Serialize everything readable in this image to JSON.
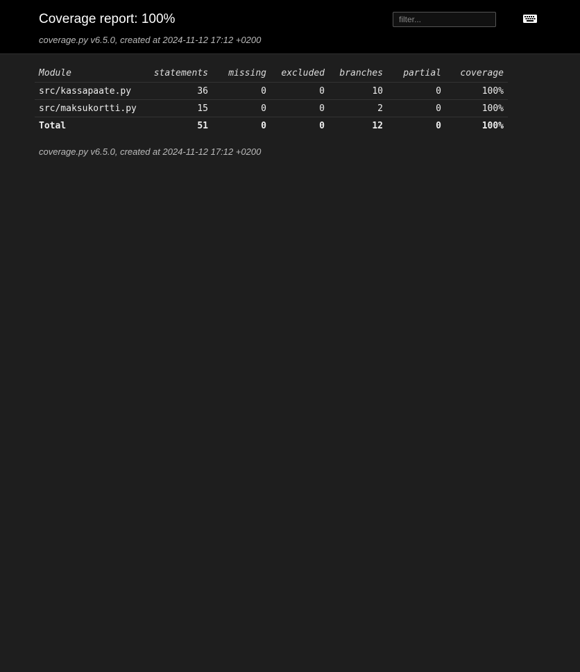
{
  "header": {
    "title": "Coverage report: 100%",
    "created": "coverage.py v6.5.0, created at 2024-11-12 17:12 +0200",
    "filter_placeholder": "filter...",
    "keyboard_icon": "keyboard-icon"
  },
  "table": {
    "columns": [
      "Module",
      "statements",
      "missing",
      "excluded",
      "branches",
      "partial",
      "coverage"
    ],
    "rows": [
      {
        "module": "src/kassapaate.py",
        "statements": "36",
        "missing": "0",
        "excluded": "0",
        "branches": "10",
        "partial": "0",
        "coverage": "100%"
      },
      {
        "module": "src/maksukortti.py",
        "statements": "15",
        "missing": "0",
        "excluded": "0",
        "branches": "2",
        "partial": "0",
        "coverage": "100%"
      }
    ],
    "total": {
      "module": "Total",
      "statements": "51",
      "missing": "0",
      "excluded": "0",
      "branches": "12",
      "partial": "0",
      "coverage": "100%"
    }
  },
  "footer": {
    "created": "coverage.py v6.5.0, created at 2024-11-12 17:12 +0200"
  },
  "colors": {
    "background": "#1e1e1e",
    "header_background": "#000000",
    "text": "#eeeeee"
  }
}
